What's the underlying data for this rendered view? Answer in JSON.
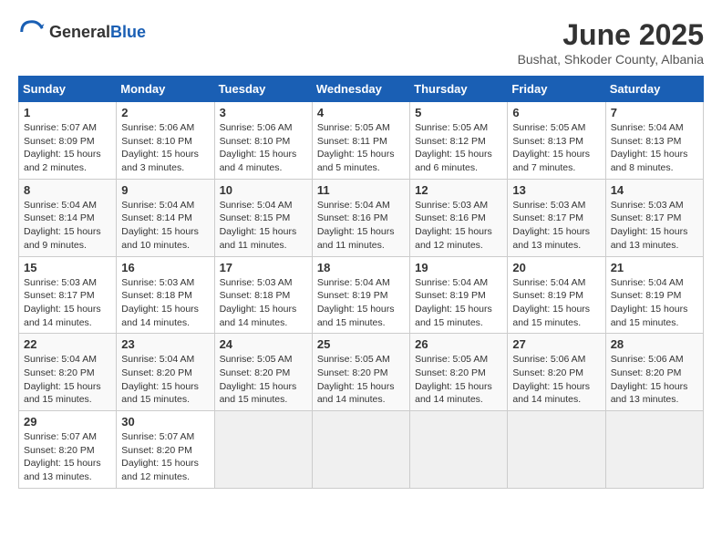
{
  "logo": {
    "text_general": "General",
    "text_blue": "Blue"
  },
  "header": {
    "title": "June 2025",
    "subtitle": "Bushat, Shkoder County, Albania"
  },
  "calendar": {
    "days_of_week": [
      "Sunday",
      "Monday",
      "Tuesday",
      "Wednesday",
      "Thursday",
      "Friday",
      "Saturday"
    ],
    "weeks": [
      [
        null,
        {
          "day": "2",
          "sunrise": "5:06 AM",
          "sunset": "8:10 PM",
          "daylight": "15 hours and 3 minutes."
        },
        {
          "day": "3",
          "sunrise": "5:06 AM",
          "sunset": "8:10 PM",
          "daylight": "15 hours and 4 minutes."
        },
        {
          "day": "4",
          "sunrise": "5:05 AM",
          "sunset": "8:11 PM",
          "daylight": "15 hours and 5 minutes."
        },
        {
          "day": "5",
          "sunrise": "5:05 AM",
          "sunset": "8:12 PM",
          "daylight": "15 hours and 6 minutes."
        },
        {
          "day": "6",
          "sunrise": "5:05 AM",
          "sunset": "8:13 PM",
          "daylight": "15 hours and 7 minutes."
        },
        {
          "day": "7",
          "sunrise": "5:04 AM",
          "sunset": "8:13 PM",
          "daylight": "15 hours and 8 minutes."
        }
      ],
      [
        {
          "day": "1",
          "sunrise": "5:07 AM",
          "sunset": "8:09 PM",
          "daylight": "15 hours and 2 minutes."
        },
        {
          "day": "9",
          "sunrise": "5:04 AM",
          "sunset": "8:14 PM",
          "daylight": "15 hours and 10 minutes."
        },
        {
          "day": "10",
          "sunrise": "5:04 AM",
          "sunset": "8:15 PM",
          "daylight": "15 hours and 11 minutes."
        },
        {
          "day": "11",
          "sunrise": "5:04 AM",
          "sunset": "8:16 PM",
          "daylight": "15 hours and 11 minutes."
        },
        {
          "day": "12",
          "sunrise": "5:03 AM",
          "sunset": "8:16 PM",
          "daylight": "15 hours and 12 minutes."
        },
        {
          "day": "13",
          "sunrise": "5:03 AM",
          "sunset": "8:17 PM",
          "daylight": "15 hours and 13 minutes."
        },
        {
          "day": "14",
          "sunrise": "5:03 AM",
          "sunset": "8:17 PM",
          "daylight": "15 hours and 13 minutes."
        }
      ],
      [
        {
          "day": "8",
          "sunrise": "5:04 AM",
          "sunset": "8:14 PM",
          "daylight": "15 hours and 9 minutes."
        },
        {
          "day": "16",
          "sunrise": "5:03 AM",
          "sunset": "8:18 PM",
          "daylight": "15 hours and 14 minutes."
        },
        {
          "day": "17",
          "sunrise": "5:03 AM",
          "sunset": "8:18 PM",
          "daylight": "15 hours and 14 minutes."
        },
        {
          "day": "18",
          "sunrise": "5:04 AM",
          "sunset": "8:19 PM",
          "daylight": "15 hours and 15 minutes."
        },
        {
          "day": "19",
          "sunrise": "5:04 AM",
          "sunset": "8:19 PM",
          "daylight": "15 hours and 15 minutes."
        },
        {
          "day": "20",
          "sunrise": "5:04 AM",
          "sunset": "8:19 PM",
          "daylight": "15 hours and 15 minutes."
        },
        {
          "day": "21",
          "sunrise": "5:04 AM",
          "sunset": "8:19 PM",
          "daylight": "15 hours and 15 minutes."
        }
      ],
      [
        {
          "day": "15",
          "sunrise": "5:03 AM",
          "sunset": "8:17 PM",
          "daylight": "15 hours and 14 minutes."
        },
        {
          "day": "23",
          "sunrise": "5:04 AM",
          "sunset": "8:20 PM",
          "daylight": "15 hours and 15 minutes."
        },
        {
          "day": "24",
          "sunrise": "5:05 AM",
          "sunset": "8:20 PM",
          "daylight": "15 hours and 15 minutes."
        },
        {
          "day": "25",
          "sunrise": "5:05 AM",
          "sunset": "8:20 PM",
          "daylight": "15 hours and 14 minutes."
        },
        {
          "day": "26",
          "sunrise": "5:05 AM",
          "sunset": "8:20 PM",
          "daylight": "15 hours and 14 minutes."
        },
        {
          "day": "27",
          "sunrise": "5:06 AM",
          "sunset": "8:20 PM",
          "daylight": "15 hours and 14 minutes."
        },
        {
          "day": "28",
          "sunrise": "5:06 AM",
          "sunset": "8:20 PM",
          "daylight": "15 hours and 13 minutes."
        }
      ],
      [
        {
          "day": "22",
          "sunrise": "5:04 AM",
          "sunset": "8:20 PM",
          "daylight": "15 hours and 15 minutes."
        },
        {
          "day": "30",
          "sunrise": "5:07 AM",
          "sunset": "8:20 PM",
          "daylight": "15 hours and 12 minutes."
        },
        null,
        null,
        null,
        null,
        null
      ],
      [
        {
          "day": "29",
          "sunrise": "5:07 AM",
          "sunset": "8:20 PM",
          "daylight": "15 hours and 13 minutes."
        },
        null,
        null,
        null,
        null,
        null,
        null
      ]
    ]
  }
}
